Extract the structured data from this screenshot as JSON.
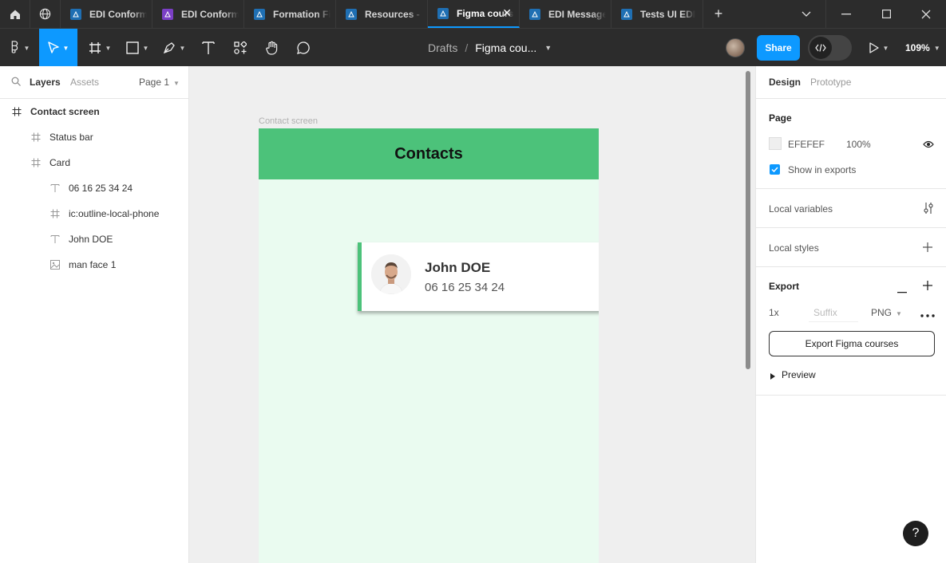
{
  "tabs": [
    {
      "label": "EDI Conformité",
      "color": "#1f6fb3"
    },
    {
      "label": "EDI Conformité",
      "color": "#7b3fc6"
    },
    {
      "label": "Formation Figma",
      "color": "#1f6fb3"
    },
    {
      "label": "Resources - Figma",
      "color": "#1f6fb3"
    },
    {
      "label": "Figma courses",
      "color": "#1f6fb3",
      "active": true
    },
    {
      "label": "EDI Messages",
      "color": "#1f6fb3"
    },
    {
      "label": "Tests UI EDI",
      "color": "#1f6fb3"
    }
  ],
  "toolbar": {
    "breadcrumb_drafts": "Drafts",
    "breadcrumb_sep": "/",
    "file_name": "Figma cou...",
    "share_label": "Share",
    "zoom": "109%"
  },
  "left_panel": {
    "tab_layers": "Layers",
    "tab_assets": "Assets",
    "page_selector": "Page 1",
    "layers": [
      {
        "name": "Contact screen",
        "type": "frame",
        "indent": 0
      },
      {
        "name": "Status bar",
        "type": "frame",
        "indent": 1
      },
      {
        "name": "Card",
        "type": "frame",
        "indent": 1
      },
      {
        "name": "06 16 25 34 24",
        "type": "text",
        "indent": 2
      },
      {
        "name": "ic:outline-local-phone",
        "type": "frame",
        "indent": 2
      },
      {
        "name": "John DOE",
        "type": "text",
        "indent": 2
      },
      {
        "name": "man face 1",
        "type": "image",
        "indent": 2
      }
    ]
  },
  "canvas": {
    "frame_label": "Contact screen",
    "header_title": "Contacts",
    "card_name": "John DOE",
    "card_phone": "06 16 25 34 24",
    "accent": "#4cc27a",
    "frame_bg": "#eafbf0"
  },
  "right_panel": {
    "tab_design": "Design",
    "tab_prototype": "Prototype",
    "page_heading": "Page",
    "page_color": "EFEFEF",
    "page_opacity": "100%",
    "show_in_exports": "Show in exports",
    "local_variables": "Local variables",
    "local_styles": "Local styles",
    "export_heading": "Export",
    "export_scale": "1x",
    "export_suffix_placeholder": "Suffix",
    "export_format": "PNG",
    "export_button": "Export Figma courses",
    "preview": "Preview"
  },
  "help_label": "?"
}
